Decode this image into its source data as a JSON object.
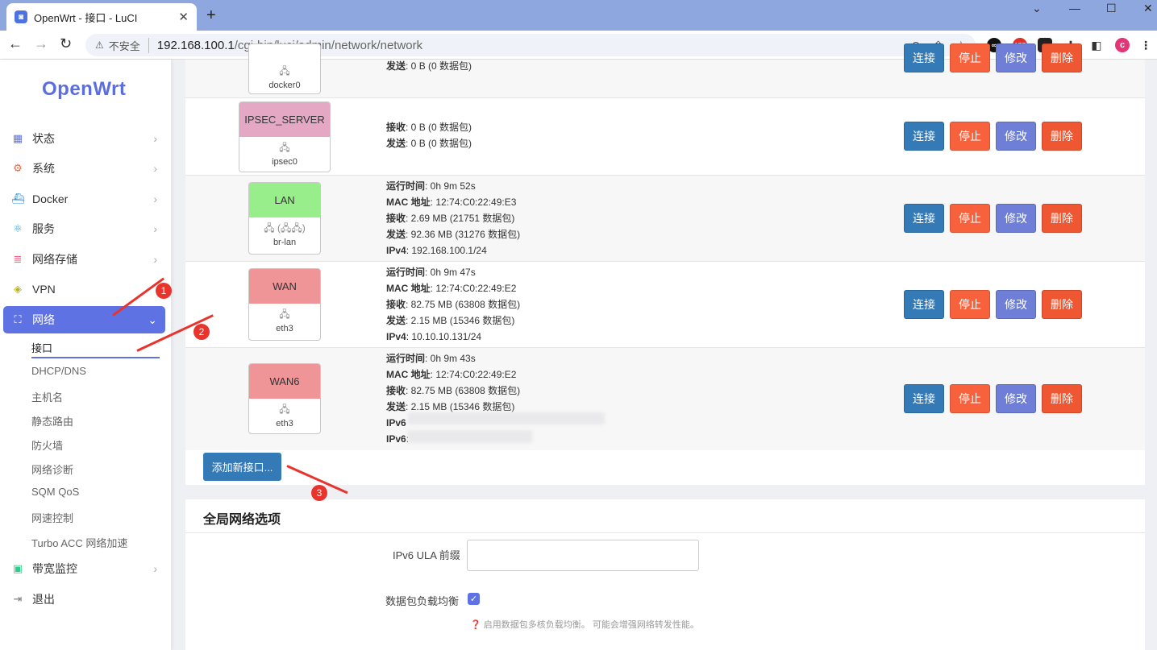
{
  "browser": {
    "tab_title": "OpenWrt - 接口 - LuCI",
    "tab_close": "✕",
    "new_tab": "+",
    "insecure_label": "不安全",
    "url_host": "192.168.100.1",
    "url_path": "/cgi-bin/luci/admin/network/network",
    "window_controls": [
      "⌄",
      "—",
      "☐",
      "✕"
    ],
    "ext_abp": "ABP",
    "ext_badge": "1",
    "profile_initial": "c"
  },
  "sidebar": {
    "logo": "OpenWrt",
    "menu": [
      {
        "label": "状态",
        "icon": "dashboard-icon"
      },
      {
        "label": "系统",
        "icon": "gear-icon"
      },
      {
        "label": "Docker",
        "icon": "docker-icon"
      },
      {
        "label": "服务",
        "icon": "services-icon"
      },
      {
        "label": "网络存储",
        "icon": "database-icon"
      },
      {
        "label": "VPN",
        "icon": "vpn-icon"
      },
      {
        "label": "网络",
        "icon": "network-icon"
      }
    ],
    "submenu": [
      "接口",
      "DHCP/DNS",
      "主机名",
      "静态路由",
      "防火墙",
      "网络诊断",
      "SQM QoS",
      "网速控制",
      "Turbo ACC 网络加速"
    ],
    "bottom_menu": [
      {
        "label": "带宽监控",
        "icon": "monitor-icon"
      },
      {
        "label": "退出",
        "icon": "logout-icon"
      }
    ],
    "accent": "#5e72e4"
  },
  "interfaces": [
    {
      "name": "",
      "device": "docker0",
      "color": "#ffffff",
      "info": [
        {
          "k": "发送",
          "v": ": 0 B (0 数据包)"
        }
      ]
    },
    {
      "name": "IPSEC_SERVER",
      "device": "ipsec0",
      "color": "#e4a8c5",
      "info": [
        {
          "k": "接收",
          "v": ": 0 B (0 数据包)"
        },
        {
          "k": "发送",
          "v": ": 0 B (0 数据包)"
        }
      ]
    },
    {
      "name": "LAN",
      "device": "br-lan",
      "color": "#98ee8a",
      "info": [
        {
          "k": "运行时间",
          "v": ": 0h 9m 52s"
        },
        {
          "k": "MAC 地址",
          "v": ": 12:74:C0:22:49:E3"
        },
        {
          "k": "接收",
          "v": ": 2.69 MB (21751 数据包)"
        },
        {
          "k": "发送",
          "v": ": 92.36 MB (31276 数据包)"
        },
        {
          "k": "IPv4",
          "v": ": 192.168.100.1/24"
        }
      ]
    },
    {
      "name": "WAN",
      "device": "eth3",
      "color": "#ef9497",
      "info": [
        {
          "k": "运行时间",
          "v": ": 0h 9m 47s"
        },
        {
          "k": "MAC 地址",
          "v": ": 12:74:C0:22:49:E2"
        },
        {
          "k": "接收",
          "v": ": 82.75 MB (63808 数据包)"
        },
        {
          "k": "发送",
          "v": ": 2.15 MB (15346 数据包)"
        },
        {
          "k": "IPv4",
          "v": ": 10.10.10.131/24"
        }
      ]
    },
    {
      "name": "WAN6",
      "device": "eth3",
      "color": "#ef9497",
      "info": [
        {
          "k": "运行时间",
          "v": ": 0h 9m 43s"
        },
        {
          "k": "MAC 地址",
          "v": ": 12:74:C0:22:49:E2"
        },
        {
          "k": "接收",
          "v": ": 82.75 MB (63808 数据包)"
        },
        {
          "k": "发送",
          "v": ": 2.15 MB (15346 数据包)"
        },
        {
          "k": "IPv6",
          "v": ""
        },
        {
          "k": "IPv6",
          "v": ":"
        }
      ]
    }
  ],
  "actions": {
    "connect": "连接",
    "stop": "停止",
    "edit": "修改",
    "delete": "删除"
  },
  "add_interface": "添加新接口...",
  "global": {
    "title": "全局网络选项",
    "ula_label": "IPv6 ULA 前缀",
    "ula_value": "",
    "packet_steering_label": "数据包负载均衡",
    "packet_steering_checked": true,
    "hint": "启用数据包多核负载均衡。 可能会增强网络转发性能。"
  },
  "annotations": [
    "1",
    "2",
    "3"
  ]
}
